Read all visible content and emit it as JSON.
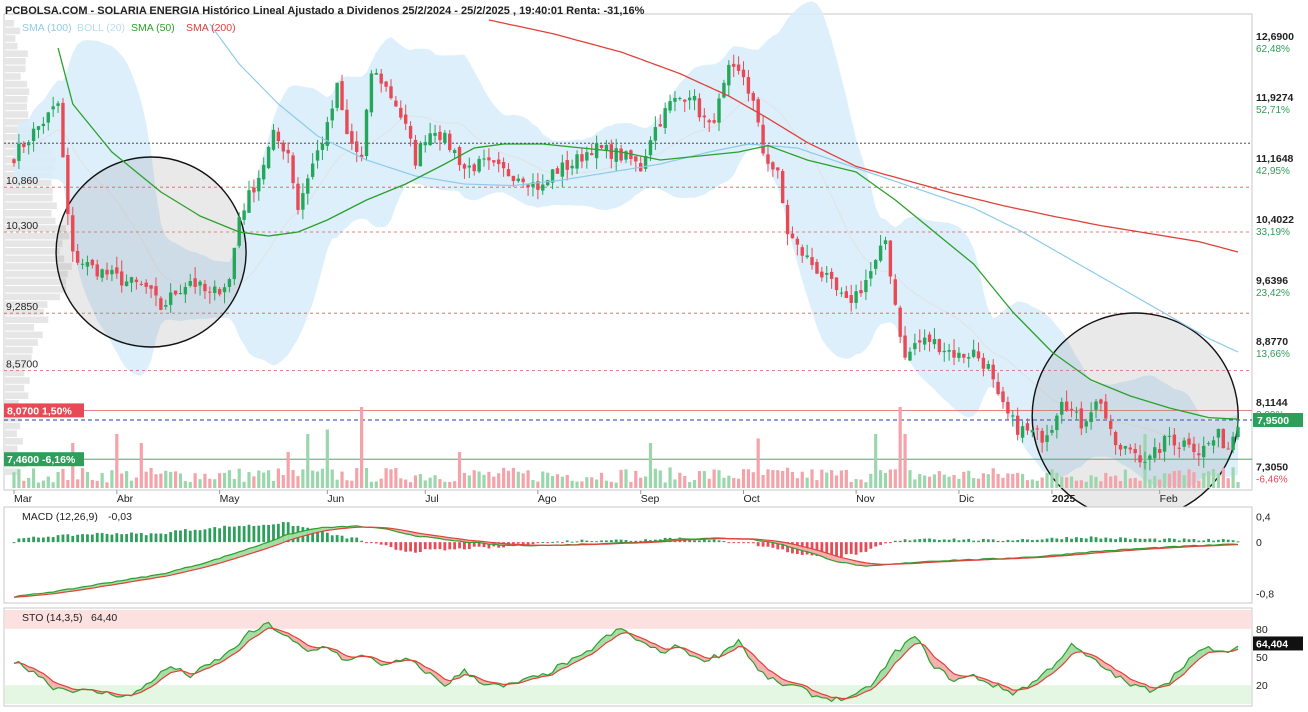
{
  "header": {
    "title": "PCBOLSA.COM - SOLARIA ENERGIA Histórico Lineal Ajustado a Dividenos 25/2/2024 - 25/2/2025 , 19:40:01 Renta: -31,16%"
  },
  "legend": [
    {
      "label": "SMA (100)",
      "color": "#8fcbea"
    },
    {
      "label": "BOLL (20)",
      "color": "#b9dcf0"
    },
    {
      "label": "SMA (50)",
      "color": "#2ca02c"
    },
    {
      "label": "SMA (200)",
      "color": "#e0413a"
    }
  ],
  "colors": {
    "up": "#26a65b",
    "down": "#e84a55",
    "boll_fill": "#d6ecfa",
    "sma100": "#8fcbea",
    "sma50": "#2ca02c",
    "sma200": "#e0413a"
  },
  "price_axis": [
    {
      "price": 12.69,
      "label": "12,6900",
      "pct": "62,48%"
    },
    {
      "price": 11.9274,
      "label": "11,9274",
      "pct": "52,71%"
    },
    {
      "price": 11.1648,
      "label": "11,1648",
      "pct": "42,95%"
    },
    {
      "price": 10.4022,
      "label": "10,4022",
      "pct": "33,19%"
    },
    {
      "price": 9.6396,
      "label": "9,6396",
      "pct": "23,42%"
    },
    {
      "price": 8.877,
      "label": "8,8770",
      "pct": "13,66%"
    },
    {
      "price": 8.1144,
      "label": "8,1144",
      "pct": "3,89%"
    },
    {
      "price": 7.305,
      "label": "7,3050",
      "pct": "-6,46%"
    }
  ],
  "current_price": {
    "price": 7.95,
    "label": "7,9500"
  },
  "levels": [
    {
      "price": 10.86,
      "label": "10,860"
    },
    {
      "price": 10.3,
      "label": "10,300"
    },
    {
      "price": 9.285,
      "label": "9,2850"
    },
    {
      "price": 8.57,
      "label": "8,5700"
    }
  ],
  "tags": [
    {
      "price": 8.07,
      "label": "8,0700  1,50%",
      "color": "#e84a55"
    },
    {
      "price": 7.46,
      "label": "7,4600  -6,16%",
      "color": "#2e9e5b"
    }
  ],
  "months": [
    {
      "label": "Mar",
      "idx": 0
    },
    {
      "label": "Abr",
      "idx": 21
    },
    {
      "label": "May",
      "idx": 42
    },
    {
      "label": "Jun",
      "idx": 64
    },
    {
      "label": "Jul",
      "idx": 84
    },
    {
      "label": "Ago",
      "idx": 107
    },
    {
      "label": "Sep",
      "idx": 128
    },
    {
      "label": "Oct",
      "idx": 149
    },
    {
      "label": "Nov",
      "idx": 172
    },
    {
      "label": "Dic",
      "idx": 193
    },
    {
      "label": "2025",
      "idx": 212
    },
    {
      "label": "Feb",
      "idx": 234
    }
  ],
  "macd": {
    "label": "MACD (12,26,9)",
    "value": "-0,03",
    "axis": [
      {
        "v": 0.4,
        "label": "0,4"
      },
      {
        "v": 0,
        "label": "0"
      },
      {
        "v": -0.8,
        "label": "-0,8"
      }
    ]
  },
  "sto": {
    "label": "STO (14,3,5)",
    "value": "64,40",
    "current": "64,404",
    "axis": [
      {
        "v": 80,
        "label": "80"
      },
      {
        "v": 50,
        "label": "50"
      },
      {
        "v": 20,
        "label": "20"
      }
    ]
  },
  "chart_data": {
    "type": "candlestick",
    "title": "SOLARIA ENERGIA Histórico Lineal Ajustado a Dividenos 25/2/2024 - 25/2/2025",
    "y_range": [
      7.1,
      12.95
    ],
    "price_anchors": [
      [
        0,
        11.25
      ],
      [
        4,
        11.55
      ],
      [
        7,
        11.75
      ],
      [
        9,
        11.9
      ],
      [
        10,
        11.2
      ],
      [
        11,
        10.5
      ],
      [
        12,
        10.0
      ],
      [
        16,
        9.85
      ],
      [
        22,
        9.7
      ],
      [
        27,
        9.6
      ],
      [
        30,
        9.35
      ],
      [
        33,
        9.55
      ],
      [
        36,
        9.7
      ],
      [
        40,
        9.5
      ],
      [
        44,
        9.7
      ],
      [
        46,
        10.5
      ],
      [
        50,
        11.0
      ],
      [
        53,
        11.5
      ],
      [
        56,
        11.3
      ],
      [
        58,
        10.6
      ],
      [
        60,
        11.0
      ],
      [
        62,
        11.3
      ],
      [
        64,
        11.6
      ],
      [
        66,
        12.1
      ],
      [
        68,
        11.5
      ],
      [
        71,
        11.2
      ],
      [
        73,
        12.3
      ],
      [
        75,
        12.2
      ],
      [
        78,
        11.9
      ],
      [
        80,
        11.6
      ],
      [
        82,
        11.2
      ],
      [
        84,
        11.5
      ],
      [
        86,
        11.6
      ],
      [
        90,
        11.3
      ],
      [
        92,
        11.1
      ],
      [
        96,
        11.15
      ],
      [
        100,
        11.05
      ],
      [
        104,
        11.0
      ],
      [
        106,
        10.9
      ],
      [
        108,
        10.85
      ],
      [
        110,
        11.05
      ],
      [
        114,
        11.15
      ],
      [
        118,
        11.35
      ],
      [
        122,
        11.3
      ],
      [
        126,
        11.2
      ],
      [
        128,
        11.1
      ],
      [
        130,
        11.5
      ],
      [
        134,
        11.9
      ],
      [
        138,
        12.05
      ],
      [
        140,
        11.8
      ],
      [
        142,
        11.6
      ],
      [
        144,
        11.9
      ],
      [
        146,
        12.3
      ],
      [
        149,
        12.25
      ],
      [
        151,
        11.9
      ],
      [
        153,
        11.3
      ],
      [
        156,
        11.0
      ],
      [
        158,
        10.3
      ],
      [
        160,
        10.1
      ],
      [
        163,
        9.9
      ],
      [
        166,
        9.7
      ],
      [
        170,
        9.4
      ],
      [
        173,
        9.6
      ],
      [
        176,
        9.9
      ],
      [
        178,
        10.2
      ],
      [
        180,
        9.4
      ],
      [
        182,
        8.7
      ],
      [
        184,
        8.9
      ],
      [
        187,
        8.95
      ],
      [
        190,
        8.85
      ],
      [
        193,
        8.75
      ],
      [
        196,
        8.8
      ],
      [
        199,
        8.6
      ],
      [
        201,
        8.2
      ],
      [
        203,
        8.0
      ],
      [
        205,
        7.85
      ],
      [
        207,
        7.8
      ],
      [
        210,
        7.75
      ],
      [
        212,
        7.9
      ],
      [
        214,
        8.25
      ],
      [
        216,
        8.05
      ],
      [
        218,
        7.9
      ],
      [
        220,
        8.1
      ],
      [
        222,
        8.2
      ],
      [
        224,
        7.75
      ],
      [
        226,
        7.55
      ],
      [
        228,
        7.6
      ],
      [
        230,
        7.5
      ],
      [
        232,
        7.45
      ],
      [
        234,
        7.6
      ],
      [
        236,
        7.75
      ],
      [
        238,
        7.65
      ],
      [
        240,
        7.7
      ],
      [
        242,
        7.55
      ],
      [
        244,
        7.65
      ],
      [
        246,
        7.75
      ],
      [
        248,
        7.6
      ],
      [
        250,
        7.95
      ]
    ],
    "volume_range": [
      0,
      10
    ],
    "volume_spikes": [
      [
        12,
        5
      ],
      [
        21,
        6
      ],
      [
        26,
        5
      ],
      [
        56,
        4
      ],
      [
        60,
        6
      ],
      [
        64,
        6.5
      ],
      [
        71,
        9
      ],
      [
        91,
        4
      ],
      [
        130,
        5
      ],
      [
        152,
        5.5
      ],
      [
        176,
        6
      ],
      [
        181,
        9
      ],
      [
        182,
        6
      ],
      [
        231,
        6
      ]
    ],
    "sma50_anchors": [
      [
        9,
        12.6
      ],
      [
        12,
        11.9
      ],
      [
        20,
        11.3
      ],
      [
        30,
        10.8
      ],
      [
        38,
        10.5
      ],
      [
        46,
        10.3
      ],
      [
        52,
        10.25
      ],
      [
        58,
        10.3
      ],
      [
        64,
        10.45
      ],
      [
        72,
        10.7
      ],
      [
        80,
        10.9
      ],
      [
        88,
        11.15
      ],
      [
        94,
        11.35
      ],
      [
        100,
        11.4
      ],
      [
        108,
        11.4
      ],
      [
        116,
        11.35
      ],
      [
        124,
        11.3
      ],
      [
        132,
        11.2
      ],
      [
        140,
        11.25
      ],
      [
        148,
        11.3
      ],
      [
        154,
        11.38
      ],
      [
        162,
        11.2
      ],
      [
        172,
        11.05
      ],
      [
        180,
        10.7
      ],
      [
        188,
        10.3
      ],
      [
        196,
        9.9
      ],
      [
        204,
        9.3
      ],
      [
        212,
        8.8
      ],
      [
        220,
        8.45
      ],
      [
        228,
        8.25
      ],
      [
        236,
        8.1
      ],
      [
        244,
        7.98
      ],
      [
        250,
        7.96
      ]
    ],
    "sma100_anchors": [
      [
        40,
        12.9
      ],
      [
        46,
        12.4
      ],
      [
        54,
        11.9
      ],
      [
        62,
        11.5
      ],
      [
        72,
        11.2
      ],
      [
        82,
        11.0
      ],
      [
        92,
        10.9
      ],
      [
        102,
        10.88
      ],
      [
        112,
        10.95
      ],
      [
        122,
        11.05
      ],
      [
        132,
        11.15
      ],
      [
        142,
        11.3
      ],
      [
        150,
        11.4
      ],
      [
        160,
        11.35
      ],
      [
        172,
        11.1
      ],
      [
        184,
        10.85
      ],
      [
        196,
        10.6
      ],
      [
        206,
        10.3
      ],
      [
        216,
        9.95
      ],
      [
        226,
        9.6
      ],
      [
        236,
        9.25
      ],
      [
        244,
        8.97
      ],
      [
        250,
        8.8
      ]
    ],
    "sma200_anchors": [
      [
        97,
        12.95
      ],
      [
        110,
        12.78
      ],
      [
        124,
        12.55
      ],
      [
        136,
        12.28
      ],
      [
        146,
        12.0
      ],
      [
        154,
        11.72
      ],
      [
        162,
        11.42
      ],
      [
        172,
        11.12
      ],
      [
        182,
        10.95
      ],
      [
        192,
        10.78
      ],
      [
        202,
        10.63
      ],
      [
        212,
        10.5
      ],
      [
        222,
        10.38
      ],
      [
        232,
        10.28
      ],
      [
        242,
        10.18
      ],
      [
        250,
        10.05
      ]
    ],
    "macd_range": [
      -0.9,
      0.5
    ],
    "macd_anchors": [
      [
        0,
        -0.85
      ],
      [
        10,
        -0.75
      ],
      [
        20,
        -0.62
      ],
      [
        30,
        -0.5
      ],
      [
        40,
        -0.3
      ],
      [
        50,
        -0.05
      ],
      [
        56,
        0.12
      ],
      [
        62,
        0.22
      ],
      [
        70,
        0.25
      ],
      [
        76,
        0.2
      ],
      [
        82,
        0.1
      ],
      [
        90,
        0.02
      ],
      [
        100,
        -0.05
      ],
      [
        110,
        -0.05
      ],
      [
        120,
        -0.02
      ],
      [
        128,
        0.0
      ],
      [
        136,
        0.05
      ],
      [
        144,
        0.06
      ],
      [
        150,
        0.05
      ],
      [
        156,
        -0.02
      ],
      [
        162,
        -0.15
      ],
      [
        168,
        -0.3
      ],
      [
        174,
        -0.38
      ],
      [
        180,
        -0.34
      ],
      [
        186,
        -0.3
      ],
      [
        192,
        -0.28
      ],
      [
        200,
        -0.26
      ],
      [
        210,
        -0.22
      ],
      [
        220,
        -0.15
      ],
      [
        230,
        -0.1
      ],
      [
        240,
        -0.06
      ],
      [
        250,
        -0.03
      ]
    ],
    "sto_range": [
      0,
      100
    ],
    "sto_anchors": [
      [
        0,
        45
      ],
      [
        4,
        35
      ],
      [
        8,
        18
      ],
      [
        12,
        15
      ],
      [
        18,
        12
      ],
      [
        24,
        8
      ],
      [
        28,
        25
      ],
      [
        32,
        40
      ],
      [
        36,
        30
      ],
      [
        40,
        42
      ],
      [
        44,
        55
      ],
      [
        48,
        75
      ],
      [
        52,
        85
      ],
      [
        56,
        70
      ],
      [
        60,
        55
      ],
      [
        64,
        62
      ],
      [
        68,
        45
      ],
      [
        72,
        52
      ],
      [
        76,
        40
      ],
      [
        80,
        48
      ],
      [
        84,
        35
      ],
      [
        88,
        20
      ],
      [
        92,
        35
      ],
      [
        96,
        22
      ],
      [
        100,
        18
      ],
      [
        104,
        25
      ],
      [
        108,
        30
      ],
      [
        112,
        42
      ],
      [
        116,
        50
      ],
      [
        120,
        68
      ],
      [
        124,
        80
      ],
      [
        128,
        66
      ],
      [
        132,
        55
      ],
      [
        136,
        62
      ],
      [
        140,
        46
      ],
      [
        144,
        52
      ],
      [
        148,
        68
      ],
      [
        152,
        35
      ],
      [
        156,
        22
      ],
      [
        160,
        18
      ],
      [
        164,
        8
      ],
      [
        168,
        5
      ],
      [
        172,
        8
      ],
      [
        176,
        25
      ],
      [
        180,
        55
      ],
      [
        184,
        72
      ],
      [
        188,
        40
      ],
      [
        192,
        25
      ],
      [
        196,
        30
      ],
      [
        200,
        20
      ],
      [
        204,
        12
      ],
      [
        208,
        22
      ],
      [
        212,
        40
      ],
      [
        216,
        62
      ],
      [
        220,
        48
      ],
      [
        224,
        34
      ],
      [
        228,
        20
      ],
      [
        232,
        15
      ],
      [
        236,
        25
      ],
      [
        240,
        48
      ],
      [
        244,
        60
      ],
      [
        248,
        52
      ],
      [
        250,
        64.4
      ]
    ]
  }
}
